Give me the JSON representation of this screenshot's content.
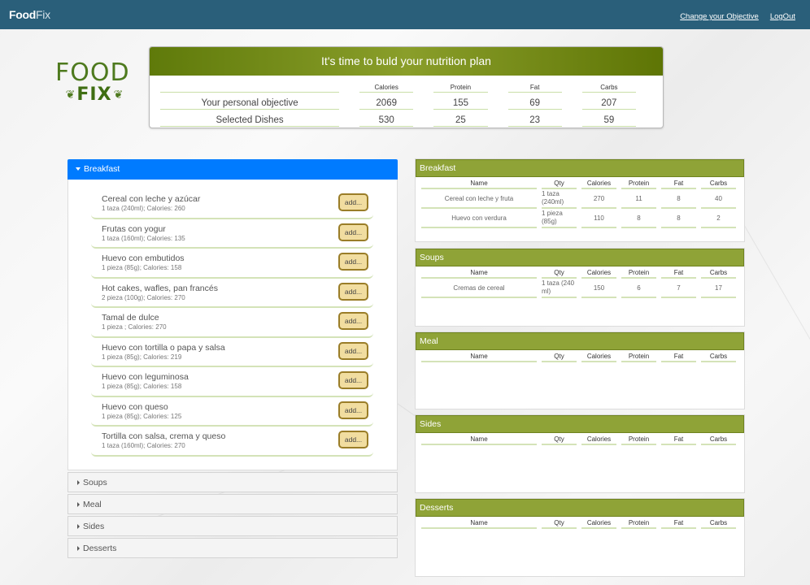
{
  "navbar": {
    "brand_food": "Food",
    "brand_fix": "Fix",
    "links": [
      "Change your Objective",
      "LogOut"
    ]
  },
  "logo": {
    "top": "FOOD",
    "bottom": "FIX"
  },
  "summary": {
    "title": "It's time to buld your nutrition plan",
    "columns": [
      "Calories",
      "Protein",
      "Fat",
      "Carbs"
    ],
    "rows": [
      {
        "label": "Your personal objective",
        "values": [
          "2069",
          "155",
          "69",
          "207"
        ]
      },
      {
        "label": "Selected Dishes",
        "values": [
          "530",
          "25",
          "23",
          "59"
        ]
      }
    ]
  },
  "accordion": {
    "active": "Breakfast",
    "add_label": "add...",
    "dishes": [
      {
        "name": "Cereal con leche y azúcar",
        "info": "1 taza (240ml); Calories: 260"
      },
      {
        "name": "Frutas con yogur",
        "info": "1 taza (160ml); Calories: 135"
      },
      {
        "name": "Huevo con embutidos",
        "info": "1 pieza (85g); Calories: 158"
      },
      {
        "name": "Hot cakes, wafles, pan francés",
        "info": "2 pieza (100g); Calories: 270"
      },
      {
        "name": "Tamal de dulce",
        "info": "1 pieza ; Calories: 270"
      },
      {
        "name": "Huevo con tortilla o papa y salsa",
        "info": "1 pieza (85g); Calories: 219"
      },
      {
        "name": "Huevo con leguminosa",
        "info": "1 pieza (85g); Calories: 158"
      },
      {
        "name": "Huevo con queso",
        "info": "1 pieza (85g); Calories: 125"
      },
      {
        "name": "Tortilla con salsa, crema y queso",
        "info": "1 taza (160ml); Calories: 270"
      }
    ],
    "collapsed": [
      "Soups",
      "Meal",
      "Sides",
      "Desserts"
    ]
  },
  "selected": {
    "columns": [
      "Name",
      "Qty",
      "Calories",
      "Protein",
      "Fat",
      "Carbs"
    ],
    "panels": [
      {
        "title": "Breakfast",
        "rows": [
          {
            "name": "Cereal con leche y fruta",
            "qty": "1 taza (240ml)",
            "calories": "270",
            "protein": "11",
            "fat": "8",
            "carbs": "40"
          },
          {
            "name": "Huevo con verdura",
            "qty": "1 pieza (85g)",
            "calories": "110",
            "protein": "8",
            "fat": "8",
            "carbs": "2"
          }
        ]
      },
      {
        "title": "Soups",
        "rows": [
          {
            "name": "Cremas de cereal",
            "qty": "1 taza (240 ml)",
            "calories": "150",
            "protein": "6",
            "fat": "7",
            "carbs": "17"
          }
        ]
      },
      {
        "title": "Meal",
        "rows": []
      },
      {
        "title": "Sides",
        "rows": []
      },
      {
        "title": "Desserts",
        "rows": []
      }
    ]
  }
}
